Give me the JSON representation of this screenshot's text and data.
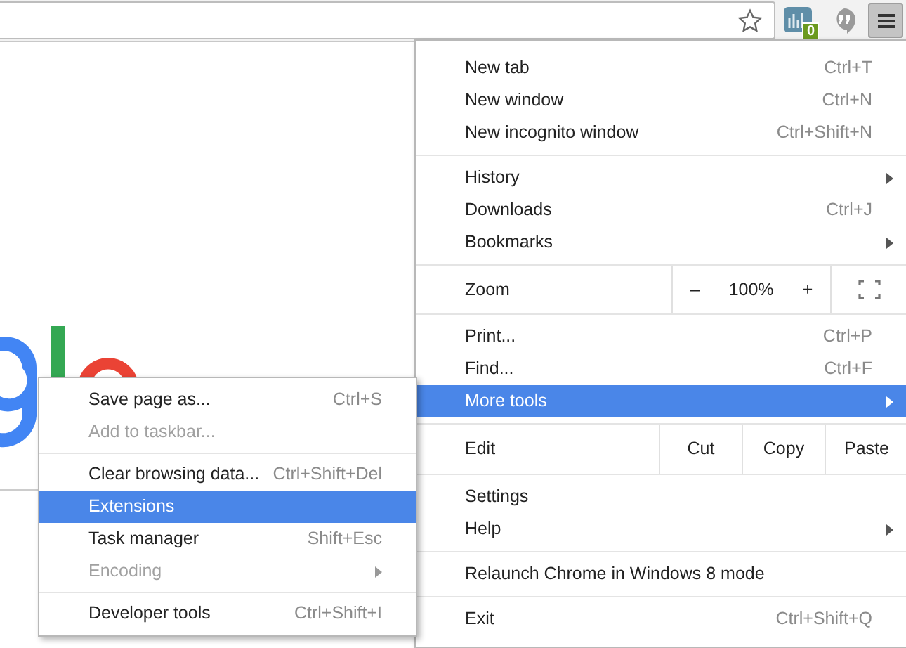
{
  "toolbar": {
    "extension_badge": "0"
  },
  "menu": {
    "sections": [
      [
        {
          "kind": "item",
          "label": "New tab",
          "shortcut": "Ctrl+T",
          "has_submenu": false,
          "selected": false
        },
        {
          "kind": "item",
          "label": "New window",
          "shortcut": "Ctrl+N",
          "has_submenu": false,
          "selected": false
        },
        {
          "kind": "item",
          "label": "New incognito window",
          "shortcut": "Ctrl+Shift+N",
          "has_submenu": false,
          "selected": false
        }
      ],
      [
        {
          "kind": "item",
          "label": "History",
          "has_submenu": true,
          "selected": false
        },
        {
          "kind": "item",
          "label": "Downloads",
          "shortcut": "Ctrl+J",
          "has_submenu": false,
          "selected": false
        },
        {
          "kind": "item",
          "label": "Bookmarks",
          "has_submenu": true,
          "selected": false
        }
      ],
      [
        {
          "kind": "zoom",
          "label": "Zoom",
          "minus": "–",
          "value": "100%",
          "plus": "+",
          "selected": false
        }
      ],
      [
        {
          "kind": "item",
          "label": "Print...",
          "shortcut": "Ctrl+P",
          "has_submenu": false,
          "selected": false
        },
        {
          "kind": "item",
          "label": "Find...",
          "shortcut": "Ctrl+F",
          "has_submenu": false,
          "selected": false
        },
        {
          "kind": "item",
          "label": "More tools",
          "has_submenu": true,
          "selected": true
        }
      ],
      [
        {
          "kind": "edit",
          "label": "Edit",
          "buttons": [
            "Cut",
            "Copy",
            "Paste"
          ],
          "selected": false
        }
      ],
      [
        {
          "kind": "item",
          "label": "Settings",
          "has_submenu": false,
          "selected": false
        },
        {
          "kind": "item",
          "label": "Help",
          "has_submenu": true,
          "selected": false
        }
      ],
      [
        {
          "kind": "item",
          "label": "Relaunch Chrome in Windows 8 mode",
          "has_submenu": false,
          "selected": false
        }
      ],
      [
        {
          "kind": "item",
          "label": "Exit",
          "shortcut": "Ctrl+Shift+Q",
          "has_submenu": false,
          "selected": false
        }
      ]
    ]
  },
  "submenu": {
    "sections": [
      [
        {
          "label": "Save page as...",
          "shortcut": "Ctrl+S",
          "has_submenu": false,
          "disabled": false,
          "selected": false
        },
        {
          "label": "Add to taskbar...",
          "has_submenu": false,
          "disabled": true,
          "selected": false
        }
      ],
      [
        {
          "label": "Clear browsing data...",
          "shortcut": "Ctrl+Shift+Del",
          "has_submenu": false,
          "disabled": false,
          "selected": false
        },
        {
          "label": "Extensions",
          "has_submenu": false,
          "disabled": false,
          "selected": true
        },
        {
          "label": "Task manager",
          "shortcut": "Shift+Esc",
          "has_submenu": false,
          "disabled": false,
          "selected": false
        },
        {
          "label": "Encoding",
          "has_submenu": true,
          "disabled": true,
          "selected": false
        }
      ],
      [
        {
          "label": "Developer tools",
          "shortcut": "Ctrl+Shift+I",
          "has_submenu": false,
          "disabled": false,
          "selected": false
        }
      ]
    ]
  }
}
